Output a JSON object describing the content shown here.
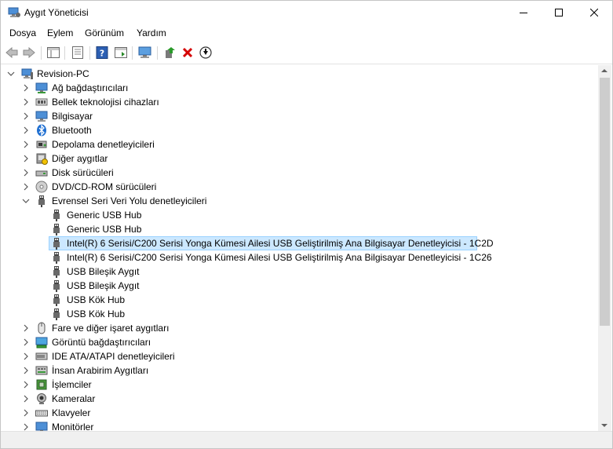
{
  "window": {
    "title": "Aygıt Yöneticisi"
  },
  "menu": [
    "Dosya",
    "Eylem",
    "Görünüm",
    "Yardım"
  ],
  "tree": {
    "root": "Revision-PC",
    "categories": [
      {
        "label": "Ağ bağdaştırıcıları",
        "icon": "network-adapter-icon",
        "expanded": false
      },
      {
        "label": "Bellek teknolojisi cihazları",
        "icon": "memory-device-icon",
        "expanded": false
      },
      {
        "label": "Bilgisayar",
        "icon": "computer-icon",
        "expanded": false
      },
      {
        "label": "Bluetooth",
        "icon": "bluetooth-icon",
        "expanded": false
      },
      {
        "label": "Depolama denetleyicileri",
        "icon": "storage-controller-icon",
        "expanded": false
      },
      {
        "label": "Diğer aygıtlar",
        "icon": "other-devices-icon",
        "expanded": false
      },
      {
        "label": "Disk sürücüleri",
        "icon": "disk-drive-icon",
        "expanded": false
      },
      {
        "label": "DVD/CD-ROM sürücüleri",
        "icon": "dvd-drive-icon",
        "expanded": false
      },
      {
        "label": "Evrensel Seri Veri Yolu denetleyicileri",
        "icon": "usb-icon",
        "expanded": true,
        "children": [
          "Generic USB Hub",
          "Generic USB Hub",
          "Intel(R) 6 Serisi/C200 Serisi Yonga Kümesi Ailesi USB Geliştirilmiş Ana Bilgisayar Denetleyicisi - 1C2D",
          "Intel(R) 6 Serisi/C200 Serisi Yonga Kümesi Ailesi USB Geliştirilmiş Ana Bilgisayar Denetleyicisi - 1C26",
          "USB Bileşik Aygıt",
          "USB Bileşik Aygıt",
          "USB Kök Hub",
          "USB Kök Hub"
        ],
        "selected_child": 2
      },
      {
        "label": "Fare ve diğer işaret aygıtları",
        "icon": "mouse-icon",
        "expanded": false
      },
      {
        "label": "Görüntü bağdaştırıcıları",
        "icon": "display-adapter-icon",
        "expanded": false
      },
      {
        "label": "IDE ATA/ATAPI denetleyicileri",
        "icon": "ide-controller-icon",
        "expanded": false
      },
      {
        "label": "İnsan Arabirim Aygıtları",
        "icon": "hid-icon",
        "expanded": false
      },
      {
        "label": "İşlemciler",
        "icon": "processor-icon",
        "expanded": false
      },
      {
        "label": "Kameralar",
        "icon": "camera-icon",
        "expanded": false
      },
      {
        "label": "Klavyeler",
        "icon": "keyboard-icon",
        "expanded": false
      },
      {
        "label": "Monitörler",
        "icon": "monitor-icon",
        "expanded": false
      }
    ]
  },
  "colors": {
    "selection": "#cce8ff",
    "selection_border": "#99d1ff",
    "delete": "#d40000"
  }
}
